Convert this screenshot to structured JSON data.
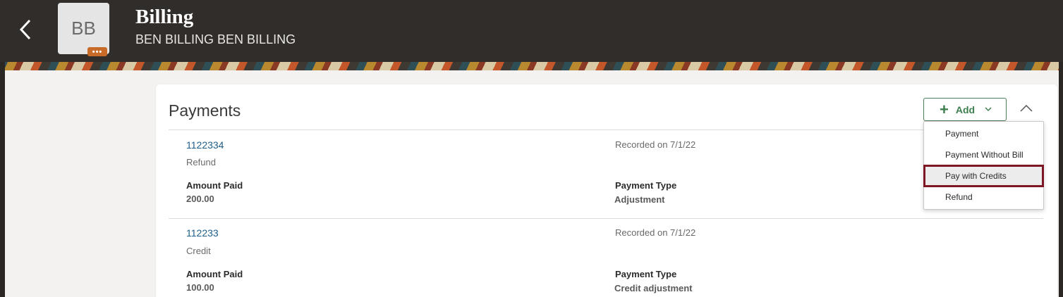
{
  "header": {
    "back_icon": "chevron-left-icon",
    "avatar_initials": "BB",
    "avatar_badge": "•••",
    "title": "Billing",
    "subtitle": "BEN BILLING BEN BILLING"
  },
  "card": {
    "title": "Payments",
    "add_label": "Add",
    "add_icon": "plus-icon",
    "collapse_icon": "chevron-up-icon"
  },
  "payments": [
    {
      "id": "1122334",
      "kind": "Refund",
      "recorded": "Recorded on 7/1/22",
      "amount_label": "Amount Paid",
      "amount": "200.00",
      "type_label": "Payment Type",
      "type": "Adjustment"
    },
    {
      "id": "112233",
      "kind": "Credit",
      "recorded": "Recorded on 7/1/22",
      "amount_label": "Amount Paid",
      "amount": "100.00",
      "type_label": "Payment Type",
      "type": "Credit adjustment"
    }
  ],
  "add_menu": {
    "items": [
      "Payment",
      "Payment Without Bill",
      "Pay with Credits",
      "Refund"
    ],
    "highlighted": "Pay with Credits"
  },
  "colors": {
    "header_bg": "#312d2a",
    "accent_green": "#3d7f4e",
    "link_blue": "#1f5d8a",
    "highlight_border": "#7d1625"
  }
}
